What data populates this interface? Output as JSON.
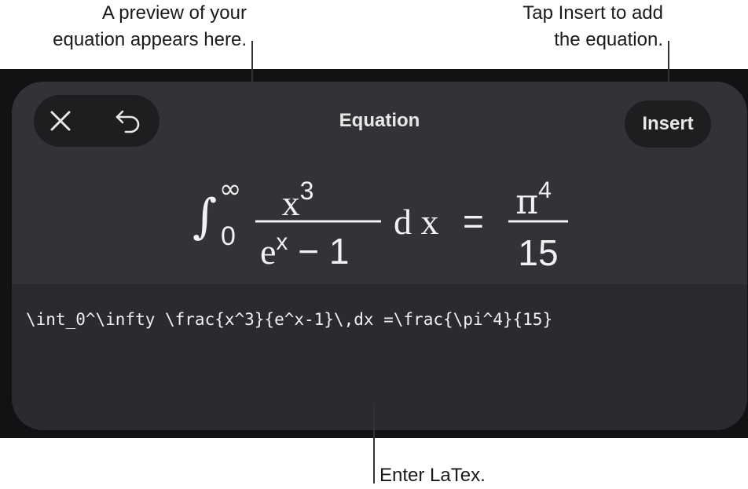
{
  "callouts": {
    "preview_line1": "A preview of your",
    "preview_line2": "equation appears here.",
    "insert_line1": "Tap Insert to add",
    "insert_line2": "the equation.",
    "latex": "Enter LaTex."
  },
  "toolbar": {
    "close_icon": "close-icon",
    "undo_icon": "undo-icon",
    "title": "Equation",
    "insert_label": "Insert"
  },
  "equation_preview": {
    "integral": "∫",
    "upper_limit": "∞",
    "lower_limit": "0",
    "numerator": "x",
    "numerator_exp": "3",
    "denominator_base": "e",
    "denominator_exp": "x",
    "denominator_rest": " − 1",
    "differential": "d x",
    "equals": "=",
    "rhs_numerator": "π",
    "rhs_numerator_exp": "4",
    "rhs_denominator": "15"
  },
  "latex_input": {
    "value": "\\int_0^\\infty \\frac{x^3}{e^x-1}\\,dx =\\frac{\\pi^4}{15}"
  },
  "colors": {
    "panel": "#2a2b2e",
    "preview_bg": "#323336",
    "button_bg": "#1d1e20",
    "text": "#e8e8e8"
  }
}
